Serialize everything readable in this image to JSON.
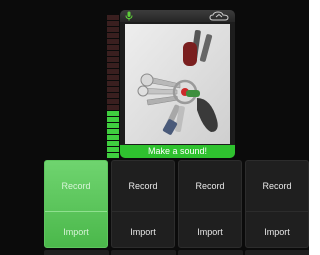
{
  "preview": {
    "caption": "Make a sound!",
    "mic_icon": "microphone-icon",
    "cloud_icon": "cloud-icon"
  },
  "meter": {
    "level": 0.32,
    "lit_color": "#3fce3f",
    "unlit_color": "#3a1f1f"
  },
  "pads": [
    {
      "record": "Record",
      "import": "Import",
      "active": true
    },
    {
      "record": "Record",
      "import": "Import",
      "active": false
    },
    {
      "record": "Record",
      "import": "Import",
      "active": false
    },
    {
      "record": "Record",
      "import": "Import",
      "active": false
    }
  ],
  "colors": {
    "accent": "#2fc22f",
    "background": "#0b0b0b"
  }
}
